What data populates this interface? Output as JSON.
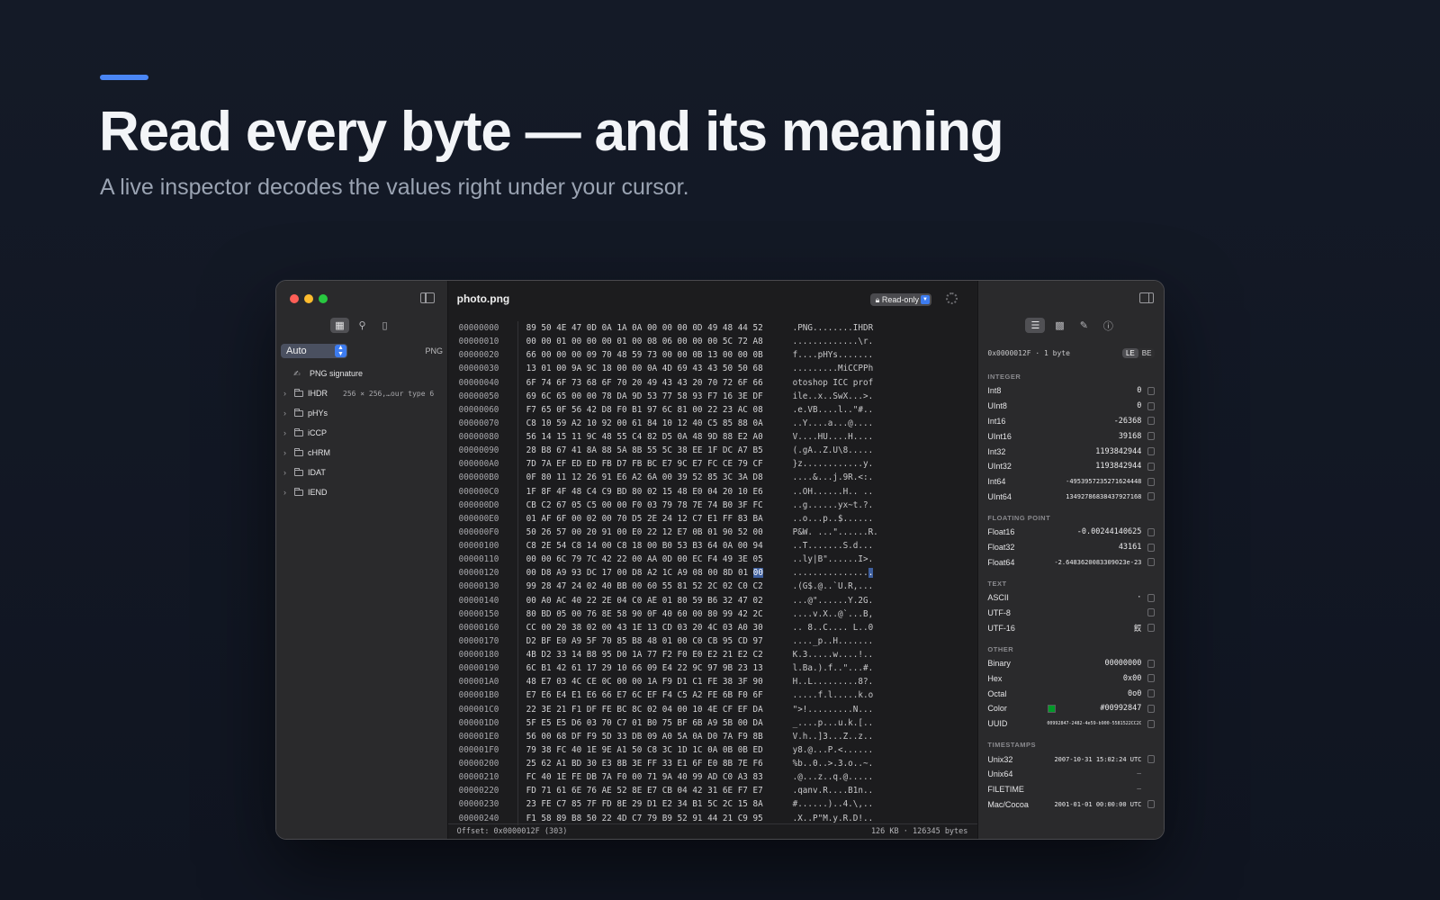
{
  "hero": {
    "title": "Read every byte — and its meaning",
    "subtitle": "A live inspector decodes the values right under your cursor."
  },
  "colors": {
    "accent": "#4a86f5",
    "selection": "#3e5f9e",
    "swatch": "#009928"
  },
  "sidebar": {
    "tools": [
      "grid-icon",
      "search-icon",
      "bookmark-icon"
    ],
    "format_select": "Auto",
    "format_label": "PNG",
    "items": [
      {
        "label": "PNG signature",
        "detail": "",
        "expandable": false,
        "icon": "signature-icon"
      },
      {
        "label": "IHDR",
        "detail": "256 × 256,…our type 6",
        "expandable": true,
        "icon": "folder-icon"
      },
      {
        "label": "pHYs",
        "detail": "",
        "expandable": true,
        "icon": "folder-icon"
      },
      {
        "label": "iCCP",
        "detail": "",
        "expandable": true,
        "icon": "folder-icon"
      },
      {
        "label": "cHRM",
        "detail": "",
        "expandable": true,
        "icon": "folder-icon"
      },
      {
        "label": "IDAT",
        "detail": "",
        "expandable": true,
        "icon": "folder-icon"
      },
      {
        "label": "IEND",
        "detail": "",
        "expandable": true,
        "icon": "folder-icon"
      }
    ]
  },
  "editor": {
    "filename": "photo.png",
    "mode": "Read-only",
    "selected": {
      "row": 18,
      "col": 15
    },
    "rows": [
      {
        "offset": "00000000",
        "bytes": "89 50 4E 47 0D 0A 1A 0A 00 00 00 0D 49 48 44 52",
        "ascii": ".PNG........IHDR"
      },
      {
        "offset": "00000010",
        "bytes": "00 00 01 00 00 00 01 00 08 06 00 00 00 5C 72 A8",
        "ascii": ".............\\r."
      },
      {
        "offset": "00000020",
        "bytes": "66 00 00 00 09 70 48 59 73 00 00 0B 13 00 00 0B",
        "ascii": "f....pHYs......."
      },
      {
        "offset": "00000030",
        "bytes": "13 01 00 9A 9C 18 00 00 0A 4D 69 43 43 50 50 68",
        "ascii": ".........MiCCPPh"
      },
      {
        "offset": "00000040",
        "bytes": "6F 74 6F 73 68 6F 70 20 49 43 43 20 70 72 6F 66",
        "ascii": "otoshop ICC prof"
      },
      {
        "offset": "00000050",
        "bytes": "69 6C 65 00 00 78 DA 9D 53 77 58 93 F7 16 3E DF",
        "ascii": "ile..x..SwX...>."
      },
      {
        "offset": "00000060",
        "bytes": "F7 65 0F 56 42 D8 F0 B1 97 6C 81 00 22 23 AC 08",
        "ascii": ".e.VB....l..\"#.."
      },
      {
        "offset": "00000070",
        "bytes": "C8 10 59 A2 10 92 00 61 84 10 12 40 C5 85 88 0A",
        "ascii": "..Y....a...@...."
      },
      {
        "offset": "00000080",
        "bytes": "56 14 15 11 9C 48 55 C4 82 D5 0A 48 9D 88 E2 A0",
        "ascii": "V....HU....H...."
      },
      {
        "offset": "00000090",
        "bytes": "28 B8 67 41 8A 88 5A 8B 55 5C 38 EE 1F DC A7 B5",
        "ascii": "(.gA..Z.U\\8....."
      },
      {
        "offset": "000000A0",
        "bytes": "7D 7A EF ED ED FB D7 FB BC E7 9C E7 FC CE 79 CF",
        "ascii": "}z............y."
      },
      {
        "offset": "000000B0",
        "bytes": "0F 80 11 12 26 91 E6 A2 6A 00 39 52 85 3C 3A D8",
        "ascii": "....&...j.9R.<:."
      },
      {
        "offset": "000000C0",
        "bytes": "1F 8F 4F 48 C4 C9 BD 80 02 15 48 E0 04 20 10 E6",
        "ascii": "..OH......H.. .."
      },
      {
        "offset": "000000D0",
        "bytes": "CB C2 67 05 C5 00 00 F0 03 79 78 7E 74 B0 3F FC",
        "ascii": "..g......yx~t.?."
      },
      {
        "offset": "000000E0",
        "bytes": "01 AF 6F 00 02 00 70 D5 2E 24 12 C7 E1 FF 83 BA",
        "ascii": "..o...p..$......"
      },
      {
        "offset": "000000F0",
        "bytes": "50 26 57 00 20 91 00 E0 22 12 E7 0B 01 90 52 00",
        "ascii": "P&W. ...\"......R."
      },
      {
        "offset": "00000100",
        "bytes": "C8 2E 54 C8 14 00 C8 18 00 B0 53 B3 64 0A 00 94",
        "ascii": "..T.......S.d..."
      },
      {
        "offset": "00000110",
        "bytes": "00 00 6C 79 7C 42 22 00 AA 0D 00 EC F4 49 3E 05",
        "ascii": "..ly|B\"......I>."
      },
      {
        "offset": "00000120",
        "bytes": "00 D8 A9 93 DC 17 00 D8 A2 1C A9 08 00 8D 01 00",
        "ascii": "................"
      },
      {
        "offset": "00000130",
        "bytes": "99 28 47 24 02 40 BB 00 60 55 81 52 2C 02 C0 C2",
        "ascii": ".(G$.@..`U.R,..."
      },
      {
        "offset": "00000140",
        "bytes": "00 A0 AC 40 22 2E 04 C0 AE 01 80 59 B6 32 47 02",
        "ascii": "...@\"......Y.2G."
      },
      {
        "offset": "00000150",
        "bytes": "80 BD 05 00 76 8E 58 90 0F 40 60 00 80 99 42 2C",
        "ascii": "....v.X..@`...B,"
      },
      {
        "offset": "00000160",
        "bytes": "CC 00 20 38 02 00 43 1E 13 CD 03 20 4C 03 A0 30",
        "ascii": ".. 8..C.... L..0"
      },
      {
        "offset": "00000170",
        "bytes": "D2 BF E0 A9 5F 70 85 B8 48 01 00 C0 CB 95 CD 97",
        "ascii": "...._p..H......."
      },
      {
        "offset": "00000180",
        "bytes": "4B D2 33 14 B8 95 D0 1A 77 F2 F0 E0 E2 21 E2 C2",
        "ascii": "K.3.....w....!.."
      },
      {
        "offset": "00000190",
        "bytes": "6C B1 42 61 17 29 10 66 09 E4 22 9C 97 9B 23 13",
        "ascii": "l.Ba.).f..\"...#."
      },
      {
        "offset": "000001A0",
        "bytes": "48 E7 03 4C CE 0C 00 00 1A F9 D1 C1 FE 38 3F 90",
        "ascii": "H..L.........8?."
      },
      {
        "offset": "000001B0",
        "bytes": "E7 E6 E4 E1 E6 66 E7 6C EF F4 C5 A2 FE 6B F0 6F",
        "ascii": ".....f.l.....k.o"
      },
      {
        "offset": "000001C0",
        "bytes": "22 3E 21 F1 DF FE BC 8C 02 04 00 10 4E CF EF DA",
        "ascii": "\">!.........N..."
      },
      {
        "offset": "000001D0",
        "bytes": "5F E5 E5 D6 03 70 C7 01 B0 75 BF 6B A9 5B 00 DA",
        "ascii": "_....p...u.k.[.."
      },
      {
        "offset": "000001E0",
        "bytes": "56 00 68 DF F9 5D 33 DB 09 A0 5A 0A D0 7A F9 8B",
        "ascii": "V.h..]3...Z..z.."
      },
      {
        "offset": "000001F0",
        "bytes": "79 38 FC 40 1E 9E A1 50 C8 3C 1D 1C 0A 0B 0B ED",
        "ascii": "y8.@...P.<......"
      },
      {
        "offset": "00000200",
        "bytes": "25 62 A1 BD 30 E3 8B 3E FF 33 E1 6F E0 8B 7E F6",
        "ascii": "%b..0..>.3.o..~."
      },
      {
        "offset": "00000210",
        "bytes": "FC 40 1E FE DB 7A F0 00 71 9A 40 99 AD C0 A3 83",
        "ascii": ".@...z..q.@....."
      },
      {
        "offset": "00000220",
        "bytes": "FD 71 61 6E 76 AE 52 8E E7 CB 04 42 31 6E F7 E7",
        "ascii": ".qanv.R....B1n.."
      },
      {
        "offset": "00000230",
        "bytes": "23 FE C7 85 7F FD 8E 29 D1 E2 34 B1 5C 2C 15 8A",
        "ascii": "#......)..4.\\,.."
      },
      {
        "offset": "00000240",
        "bytes": "F1 58 89 B8 50 22 4D C7 79 B9 52 91 44 21 C9 95",
        "ascii": ".X..P\"M.y.R.D!.."
      }
    ],
    "status_left": "Offset: 0x0000012F (303)",
    "status_right": "126 KB · 126345 bytes"
  },
  "inspector": {
    "tabs": [
      "list-icon",
      "chart-icon",
      "pencil-icon",
      "info-icon"
    ],
    "offset_text": "0x0000012F · 1 byte",
    "endian": [
      "LE",
      "BE"
    ],
    "sections": [
      {
        "title": "INTEGER",
        "rows": [
          {
            "label": "Int8",
            "value": "0"
          },
          {
            "label": "UInt8",
            "value": "0"
          },
          {
            "label": "Int16",
            "value": "-26368"
          },
          {
            "label": "UInt16",
            "value": "39168"
          },
          {
            "label": "Int32",
            "value": "1193842944"
          },
          {
            "label": "UInt32",
            "value": "1193842944"
          },
          {
            "label": "Int64",
            "value": "-4953957235271624448"
          },
          {
            "label": "UInt64",
            "value": "13492786838437927168"
          }
        ]
      },
      {
        "title": "FLOATING POINT",
        "rows": [
          {
            "label": "Float16",
            "value": "-0.00244140625"
          },
          {
            "label": "Float32",
            "value": "43161"
          },
          {
            "label": "Float64",
            "value": "-2.6483620083309023e-23"
          }
        ]
      },
      {
        "title": "TEXT",
        "rows": [
          {
            "label": "ASCII",
            "value": "·"
          },
          {
            "label": "UTF-8",
            "value": ""
          },
          {
            "label": "UTF-16",
            "value": "餀"
          }
        ]
      },
      {
        "title": "OTHER",
        "rows": [
          {
            "label": "Binary",
            "value": "00000000"
          },
          {
            "label": "Hex",
            "value": "0x00"
          },
          {
            "label": "Octal",
            "value": "0o0"
          },
          {
            "label": "Color",
            "value": "#00992847"
          },
          {
            "label": "UUID",
            "value": "00992847-2482-4e59-b900-5581522CC2C0"
          }
        ]
      },
      {
        "title": "TIMESTAMPS",
        "rows": [
          {
            "label": "Unix32",
            "value": "2007-10-31 15:02:24 UTC"
          },
          {
            "label": "Unix64",
            "value": "—"
          },
          {
            "label": "FILETIME",
            "value": "—"
          },
          {
            "label": "Mac/Cocoa",
            "value": "2001-01-01 00:00:00 UTC"
          }
        ]
      }
    ]
  }
}
